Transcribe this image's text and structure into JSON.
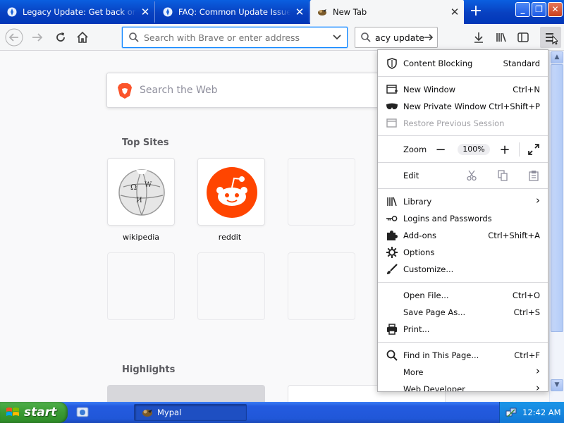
{
  "browser": {
    "tabs": [
      {
        "title": "Legacy Update: Get back online, active",
        "close": "✕",
        "active": false
      },
      {
        "title": "FAQ: Common Update Issues - Le",
        "close": "✕",
        "active": false
      },
      {
        "title": "New Tab",
        "close": "✕",
        "active": true
      }
    ],
    "new_tab_symbol": "+",
    "window_controls": {
      "minimize": "_",
      "maximize": "❐",
      "close": "✕"
    }
  },
  "toolbar": {
    "url_placeholder": "Search with Brave or enter address",
    "search_value": "legacy update"
  },
  "new_tab_page": {
    "web_search_placeholder": "Search the Web",
    "top_sites_heading": "Top Sites",
    "top_sites": [
      {
        "label": "wikipedia"
      },
      {
        "label": "reddit"
      }
    ],
    "highlights_heading": "Highlights"
  },
  "app_menu": {
    "content_blocking": {
      "label": "Content Blocking",
      "value": "Standard"
    },
    "new_window": {
      "label": "New Window",
      "shortcut": "Ctrl+N"
    },
    "new_private_window": {
      "label": "New Private Window",
      "shortcut": "Ctrl+Shift+P"
    },
    "restore_session": {
      "label": "Restore Previous Session"
    },
    "zoom": {
      "label": "Zoom",
      "minus": "−",
      "value": "100%",
      "plus": "+"
    },
    "edit": {
      "label": "Edit"
    },
    "library": {
      "label": "Library"
    },
    "logins": {
      "label": "Logins and Passwords"
    },
    "addons": {
      "label": "Add-ons",
      "shortcut": "Ctrl+Shift+A"
    },
    "options": {
      "label": "Options"
    },
    "customize": {
      "label": "Customize..."
    },
    "open_file": {
      "label": "Open File...",
      "shortcut": "Ctrl+O"
    },
    "save_page": {
      "label": "Save Page As...",
      "shortcut": "Ctrl+S"
    },
    "print": {
      "label": "Print..."
    },
    "find": {
      "label": "Find in This Page...",
      "shortcut": "Ctrl+F"
    },
    "more": {
      "label": "More"
    },
    "web_developer": {
      "label": "Web Developer"
    },
    "submenu_arrow": "›"
  },
  "taskbar": {
    "start_label": "start",
    "task_label": "Mypal",
    "clock": "12:42 AM"
  },
  "colors": {
    "brave_orange": "#fb542b",
    "reddit_orange": "#ff4500",
    "xp_blue": "#245be0",
    "xp_green": "#3a9a33",
    "focus_blue": "#0a84ff"
  }
}
